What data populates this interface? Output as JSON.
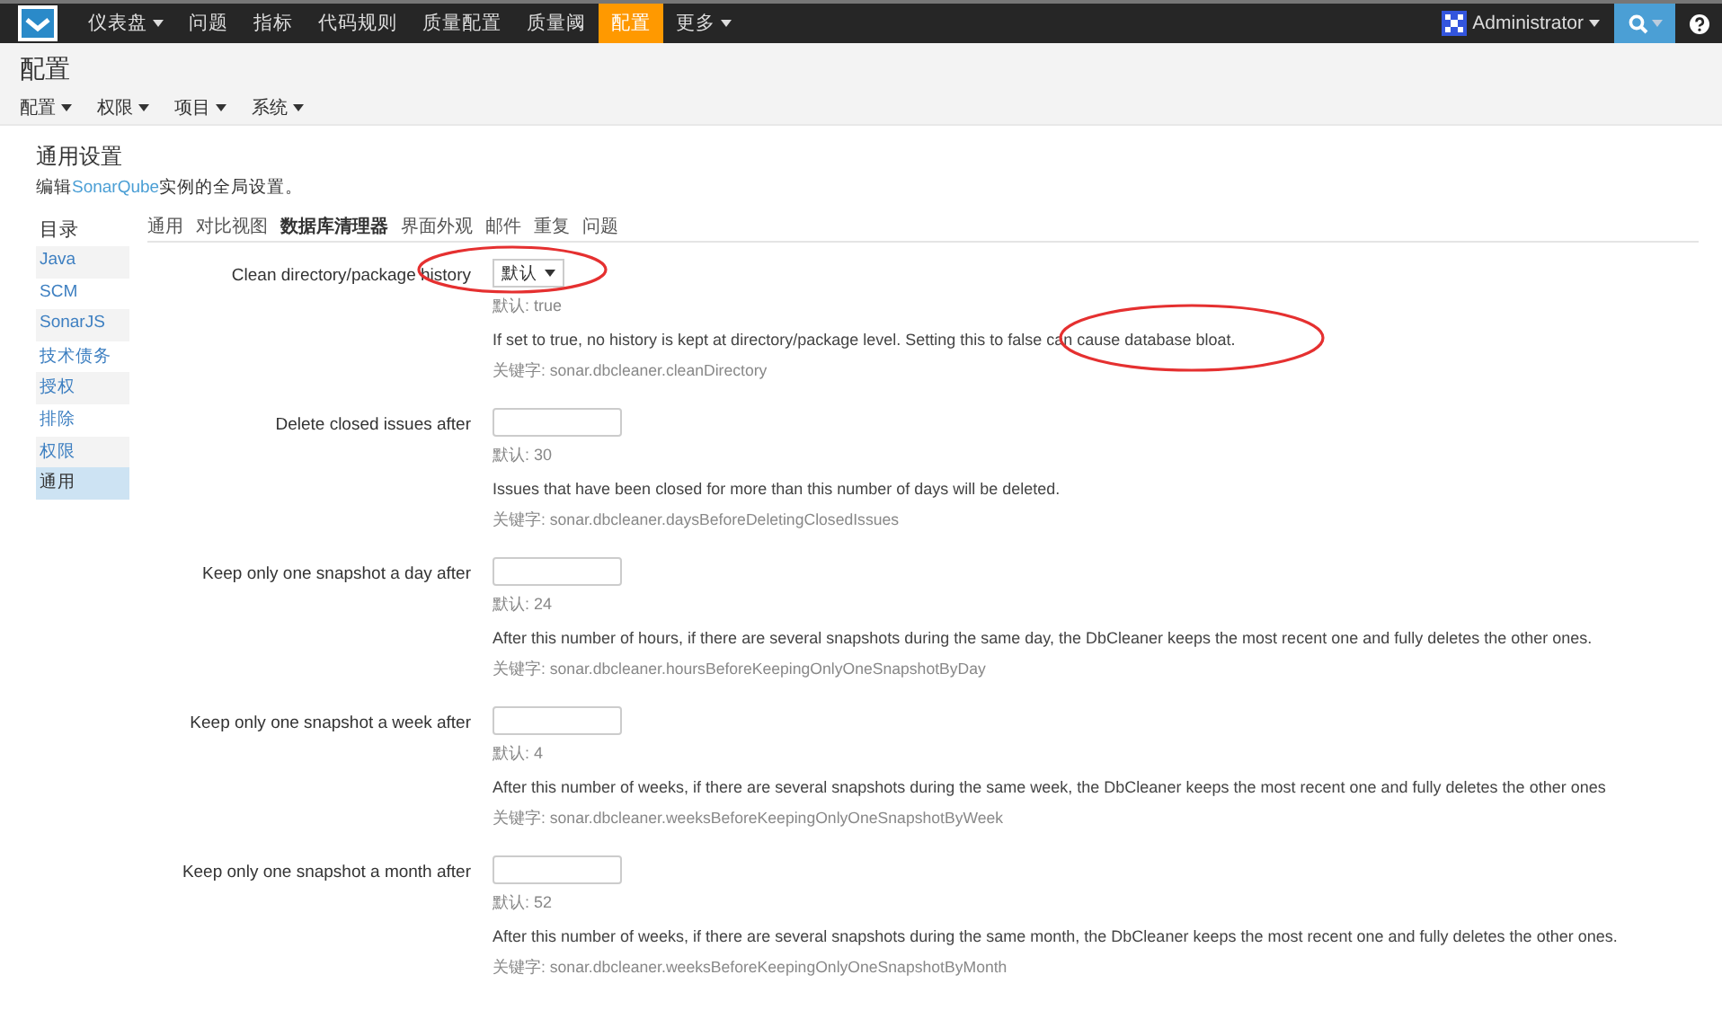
{
  "topnav": {
    "items": [
      {
        "label": "仪表盘",
        "dropdown": true,
        "selected": false
      },
      {
        "label": "问题",
        "dropdown": false,
        "selected": false
      },
      {
        "label": "指标",
        "dropdown": false,
        "selected": false
      },
      {
        "label": "代码规则",
        "dropdown": false,
        "selected": false
      },
      {
        "label": "质量配置",
        "dropdown": false,
        "selected": false
      },
      {
        "label": "质量阈",
        "dropdown": false,
        "selected": false
      },
      {
        "label": "配置",
        "dropdown": false,
        "selected": true
      },
      {
        "label": "更多",
        "dropdown": true,
        "selected": false
      }
    ],
    "user": "Administrator"
  },
  "page": {
    "title": "配置",
    "submenu": [
      {
        "label": "配置"
      },
      {
        "label": "权限"
      },
      {
        "label": "项目"
      },
      {
        "label": "系统"
      }
    ]
  },
  "section": {
    "title": "通用设置",
    "subtitle_before": "编辑",
    "subtitle_link": "SonarQube",
    "subtitle_after": "实例的全局设置。"
  },
  "sidebar": {
    "heading": "目录",
    "items": [
      {
        "label": "Java",
        "selected": false
      },
      {
        "label": "SCM",
        "selected": false
      },
      {
        "label": "SonarJS",
        "selected": false
      },
      {
        "label": "技术债务",
        "selected": false
      },
      {
        "label": "授权",
        "selected": false
      },
      {
        "label": "排除",
        "selected": false
      },
      {
        "label": "权限",
        "selected": false
      },
      {
        "label": "通用",
        "selected": true
      }
    ]
  },
  "tabs": [
    {
      "label": "通用",
      "selected": false
    },
    {
      "label": "对比视图",
      "selected": false
    },
    {
      "label": "数据库清理器",
      "selected": true
    },
    {
      "label": "界面外观",
      "selected": false
    },
    {
      "label": "邮件",
      "selected": false
    },
    {
      "label": "重复",
      "selected": false
    },
    {
      "label": "问题",
      "selected": false
    }
  ],
  "settings": [
    {
      "label": "Clean directory/package history",
      "kind": "select",
      "value": "默认",
      "default": "默认: true",
      "description": "If set to true, no history is kept at directory/package level. Setting this to false can cause database bloat.",
      "key": "关键字: sonar.dbcleaner.cleanDirectory"
    },
    {
      "label": "Delete closed issues after",
      "kind": "text",
      "default": "默认: 30",
      "description": "Issues that have been closed for more than this number of days will be deleted.",
      "key": "关键字: sonar.dbcleaner.daysBeforeDeletingClosedIssues"
    },
    {
      "label": "Keep only one snapshot a day after",
      "kind": "text",
      "default": "默认: 24",
      "description": "After this number of hours, if there are several snapshots during the same day, the DbCleaner keeps the most recent one and fully deletes the other ones.",
      "key": "关键字: sonar.dbcleaner.hoursBeforeKeepingOnlyOneSnapshotByDay"
    },
    {
      "label": "Keep only one snapshot a week after",
      "kind": "text",
      "default": "默认: 4",
      "description": "After this number of weeks, if there are several snapshots during the same week, the DbCleaner keeps the most recent one and fully deletes the other ones",
      "key": "关键字: sonar.dbcleaner.weeksBeforeKeepingOnlyOneSnapshotByWeek"
    },
    {
      "label": "Keep only one snapshot a month after",
      "kind": "text",
      "default": "默认: 52",
      "description": "After this number of weeks, if there are several snapshots during the same month, the DbCleaner keeps the most recent one and fully deletes the other ones.",
      "key": "关键字: sonar.dbcleaner.weeksBeforeKeepingOnlyOneSnapshotByMonth"
    }
  ]
}
